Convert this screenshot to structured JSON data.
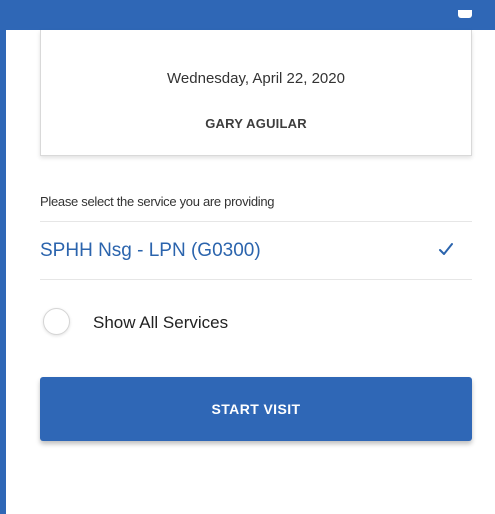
{
  "visit": {
    "date": "Wednesday, April 22, 2020",
    "client_name": "GARY AGUILAR"
  },
  "service": {
    "prompt": "Please select the service you are providing",
    "selected": "SPHH Nsg - LPN (G0300)",
    "selected_icon": "check-icon",
    "show_all_label": "Show All Services",
    "show_all_checked": false
  },
  "actions": {
    "start_visit_label": "START VISIT"
  },
  "colors": {
    "brand_blue": "#2f67b6",
    "link_blue": "#2b64ad"
  }
}
